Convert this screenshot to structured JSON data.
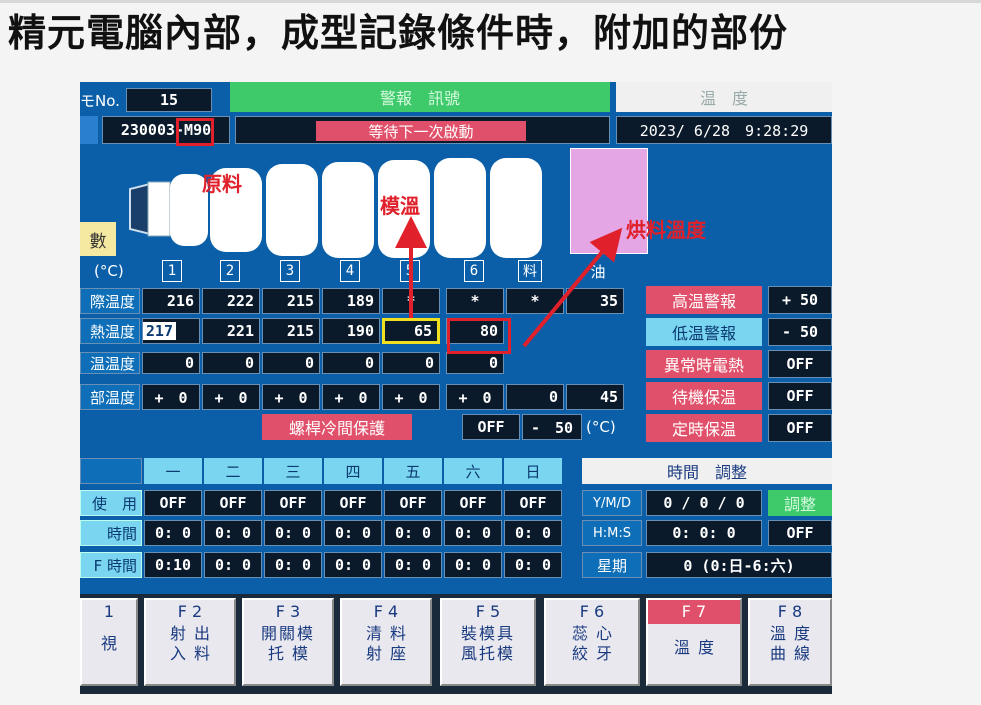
{
  "slide_title": "精元電腦內部，成型記錄條件時，附加的部份",
  "header": {
    "no_label": "モNo.",
    "no_value": "15",
    "alarm_title": "警報　訊號",
    "temp_title": "温　度",
    "mold_value": "230003-M90",
    "status_message": "等待下一次啟動",
    "datetime": "2023/ 6/28　9:28:29"
  },
  "annotations": {
    "material": "原料",
    "mold_temp": "模溫",
    "drying_temp": "烘料溫度"
  },
  "barrel": {
    "side_label": "數",
    "unit": "(°C)",
    "zones": [
      "1",
      "2",
      "3",
      "4",
      "5",
      "6",
      "料",
      "油"
    ]
  },
  "temp_table": {
    "rows": [
      {
        "label": "際温度",
        "values": [
          "216",
          "222",
          "215",
          "189",
          "*",
          "*",
          "*",
          "35"
        ]
      },
      {
        "label": "熱温度",
        "values": [
          "217",
          "221",
          "215",
          "190",
          "65",
          "80"
        ]
      },
      {
        "label": "温温度",
        "values": [
          "0",
          "0",
          "0",
          "0",
          "0",
          "0"
        ]
      },
      {
        "label": "部温度",
        "values": [
          "+　0",
          "+　0",
          "+　0",
          "+　0",
          "+　0",
          "+　0",
          "0",
          "45"
        ]
      }
    ],
    "screw_label": "螺桿冷間保護",
    "screw_value": "OFF",
    "screw_offset": "-　50",
    "screw_unit": "(°C)"
  },
  "alarms": [
    {
      "label": "高温警報",
      "value": "+ 50",
      "style": "pink"
    },
    {
      "label": "低温警報",
      "value": "- 50",
      "style": "cyan"
    },
    {
      "label": "異常時電熱",
      "value": "OFF",
      "style": "pink"
    },
    {
      "label": "待機保温",
      "value": "OFF",
      "style": "pink"
    },
    {
      "label": "定時保温",
      "value": "OFF",
      "style": "pink"
    }
  ],
  "schedule": {
    "days": [
      "一",
      "二",
      "三",
      "四",
      "五",
      "六",
      "日"
    ],
    "rows": [
      {
        "label": "使　用",
        "values": [
          "OFF",
          "OFF",
          "OFF",
          "OFF",
          "OFF",
          "OFF",
          "OFF"
        ]
      },
      {
        "label": "時間",
        "values": [
          "0: 0",
          "0: 0",
          "0: 0",
          "0: 0",
          "0: 0",
          "0: 0",
          "0: 0"
        ]
      },
      {
        "label": "F 時間",
        "values": [
          "0:10",
          "0: 0",
          "0: 0",
          "0: 0",
          "0: 0",
          "0: 0",
          "0: 0"
        ]
      }
    ]
  },
  "time_adjust": {
    "title": "時間　調整",
    "ymd_label": "Y/M/D",
    "ymd_value": "0 / 0 / 0",
    "adjust_button": "調整",
    "hms_label": "H:M:S",
    "hms_value": "0: 0: 0",
    "hms_toggle": "OFF",
    "weekday_label": "星期",
    "weekday_value": "0 (0:日-6:六)"
  },
  "function_keys": [
    {
      "key": "1",
      "l1": "視",
      "l2": ""
    },
    {
      "key": "F 2",
      "l1": "射出",
      "l2": "入料"
    },
    {
      "key": "F 3",
      "l1": "開關模",
      "l2": "托模"
    },
    {
      "key": "F 4",
      "l1": "清料",
      "l2": "射座"
    },
    {
      "key": "F 5",
      "l1": "裝模具",
      "l2": "風托模"
    },
    {
      "key": "F 6",
      "l1": "蕊心",
      "l2": "絞牙"
    },
    {
      "key": "F 7",
      "l1": "溫度",
      "l2": ""
    },
    {
      "key": "F 8",
      "l1": "溫度",
      "l2": "曲線"
    }
  ]
}
